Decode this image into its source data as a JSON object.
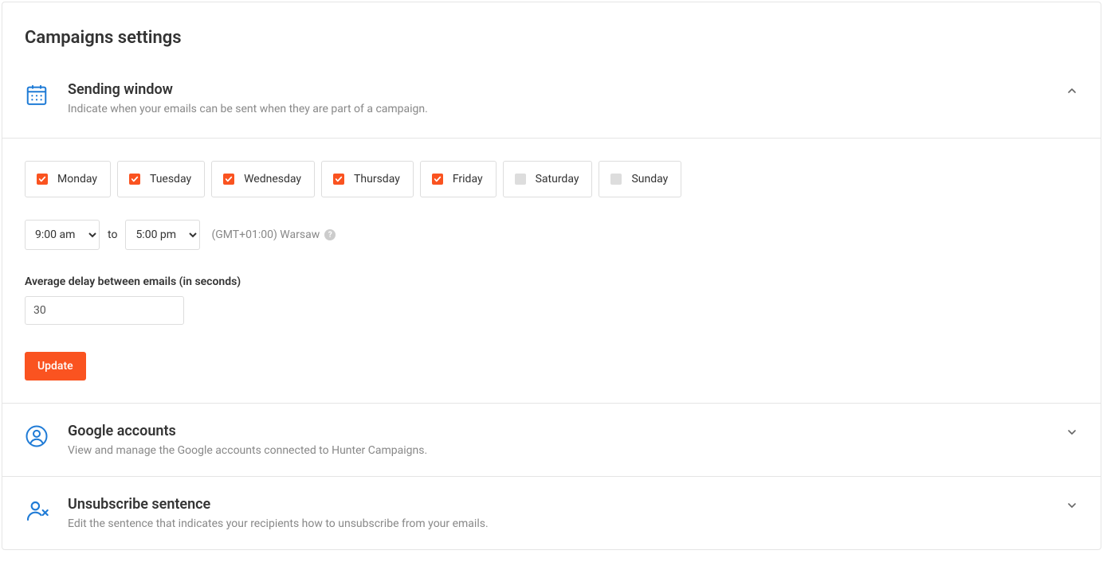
{
  "page_title": "Campaigns settings",
  "sending_window": {
    "title": "Sending window",
    "description": "Indicate when your emails can be sent when they are part of a campaign.",
    "days": [
      {
        "label": "Monday",
        "checked": true
      },
      {
        "label": "Tuesday",
        "checked": true
      },
      {
        "label": "Wednesday",
        "checked": true
      },
      {
        "label": "Thursday",
        "checked": true
      },
      {
        "label": "Friday",
        "checked": true
      },
      {
        "label": "Saturday",
        "checked": false
      },
      {
        "label": "Sunday",
        "checked": false
      }
    ],
    "time_from": "9:00 am",
    "time_to_word": "to",
    "time_to": "5:00 pm",
    "timezone": "(GMT+01:00) Warsaw",
    "delay_label": "Average delay between emails (in seconds)",
    "delay_value": "30",
    "update_label": "Update"
  },
  "google_accounts": {
    "title": "Google accounts",
    "description": "View and manage the Google accounts connected to Hunter Campaigns."
  },
  "unsubscribe": {
    "title": "Unsubscribe sentence",
    "description": "Edit the sentence that indicates your recipients how to unsubscribe from your emails."
  }
}
